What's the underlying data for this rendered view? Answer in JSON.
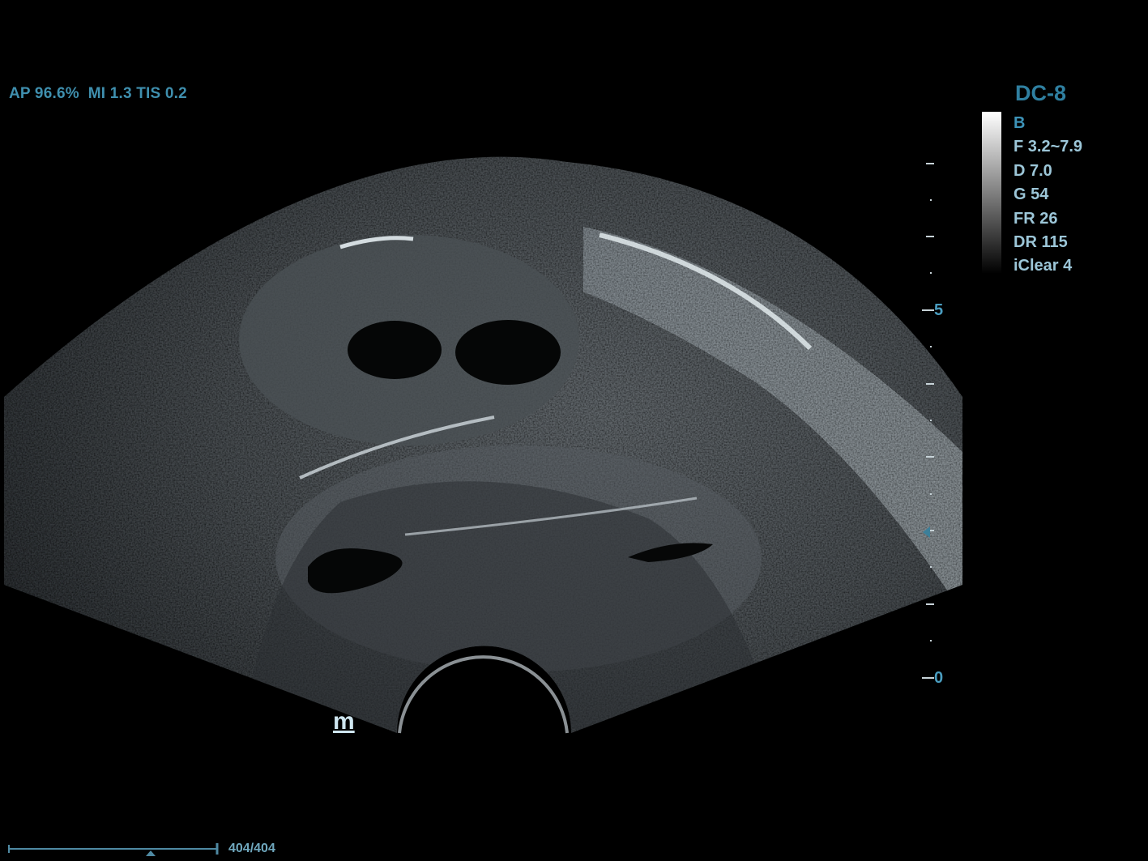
{
  "header": {
    "readout": "AP 96.6%  MI 1.3 TIS 0.2"
  },
  "probe": {
    "name": "DC-8",
    "mode": "B",
    "params": [
      "F 3.2~7.9",
      "D 7.0",
      "G 54",
      "FR 26",
      "DR 115",
      "iClear 4"
    ]
  },
  "depth_scale": {
    "labels": [
      "5",
      "0"
    ]
  },
  "orientation_marker": "m",
  "cine": {
    "counter": "404/404"
  },
  "colors": {
    "accent": "#3f8fae",
    "text": "#9cc6d8",
    "background": "#000000"
  }
}
